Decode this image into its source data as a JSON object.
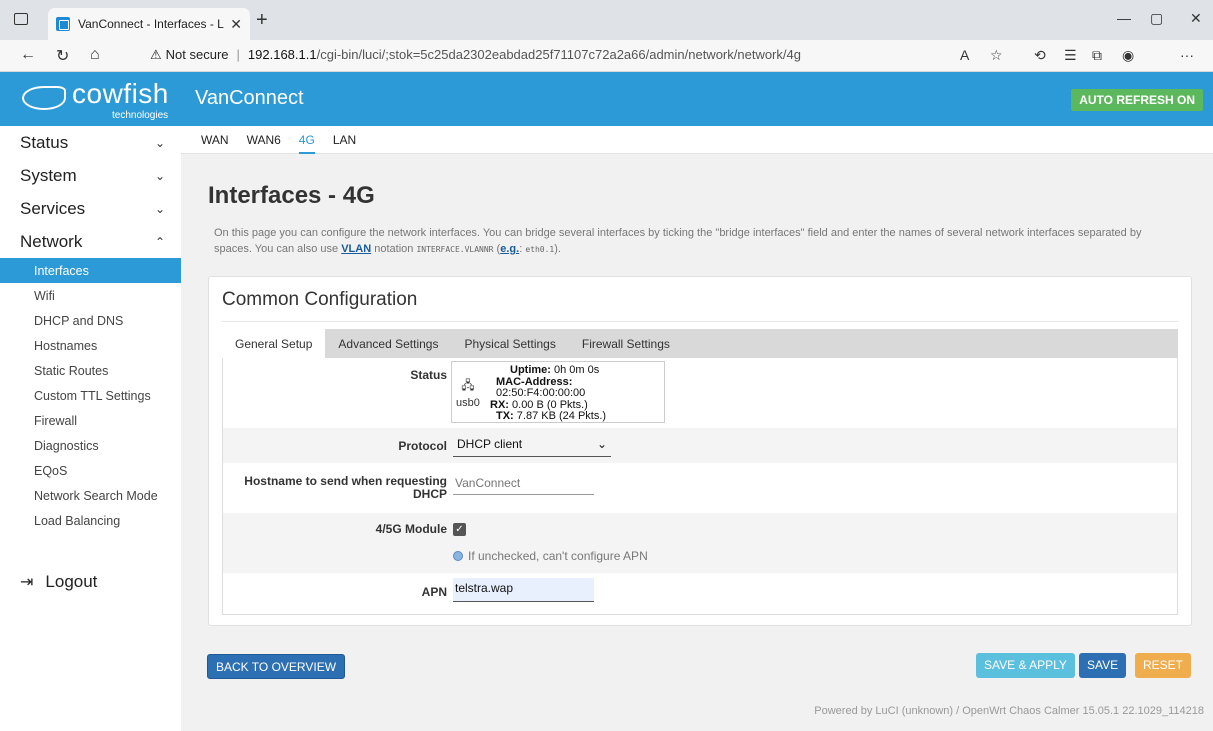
{
  "browser": {
    "tab_title": "VanConnect - Interfaces - LuCI",
    "security": "Not secure",
    "url_host": "192.168.1.1",
    "url_path": "/cgi-bin/luci/;stok=5c25da2302eabdad25f71107c72a2a66/admin/network/network/4g"
  },
  "header": {
    "brand": "cowfish",
    "brand_tag": "technologies",
    "app_name": "VanConnect",
    "auto_refresh": "AUTO REFRESH ON"
  },
  "sidebar": {
    "sections": [
      {
        "label": "Status",
        "chevron": "⌄"
      },
      {
        "label": "System",
        "chevron": "⌄"
      },
      {
        "label": "Services",
        "chevron": "⌄"
      },
      {
        "label": "Network",
        "chevron": "⌃"
      }
    ],
    "network_items": [
      "Interfaces",
      "Wifi",
      "DHCP and DNS",
      "Hostnames",
      "Static Routes",
      "Custom TTL Settings",
      "Firewall",
      "Diagnostics",
      "EQoS",
      "Network Search Mode",
      "Load Balancing"
    ],
    "logout": "Logout"
  },
  "iface_tabs": [
    "WAN",
    "WAN6",
    "4G",
    "LAN"
  ],
  "page": {
    "title": "Interfaces - 4G",
    "desc_1": "On this page you can configure the network interfaces. You can bridge several interfaces by ticking the \"bridge interfaces\" field and enter the names of several network interfaces separated by spaces. You can also use ",
    "desc_link": "VLAN",
    "desc_2": " notation ",
    "desc_code1": "INTERFACE.VLANNR",
    "desc_3": " (",
    "desc_eg": "e.g.",
    "desc_4": ": ",
    "desc_code2": "eth0.1",
    "desc_5": ")."
  },
  "panel": {
    "title": "Common Configuration",
    "tabs": [
      "General Setup",
      "Advanced Settings",
      "Physical Settings",
      "Firewall Settings"
    ]
  },
  "form": {
    "status_label": "Status",
    "device": "usb0",
    "uptime_key": "Uptime:",
    "uptime_val": "0h 0m 0s",
    "mac_key": "MAC-Address:",
    "mac_val": "02:50:F4:00:00:00",
    "rx_key": "RX:",
    "rx_val": "0.00 B (0 Pkts.)",
    "tx_key": "TX:",
    "tx_val": "7.87 KB (24 Pkts.)",
    "protocol_label": "Protocol",
    "protocol_value": "DHCP client",
    "hostname_label_1": "Hostname to send when requesting",
    "hostname_label_2": "DHCP",
    "hostname_placeholder": "VanConnect",
    "module_label": "4/5G Module",
    "module_checked": true,
    "module_hint": "If unchecked, can't configure APN",
    "apn_label": "APN",
    "apn_value": "telstra.wap"
  },
  "buttons": {
    "back": "BACK TO OVERVIEW",
    "save_apply": "SAVE & APPLY",
    "save": "SAVE",
    "reset": "RESET"
  },
  "footer": "Powered by LuCI (unknown) / OpenWrt Chaos Calmer 15.05.1 22.1029_114218",
  "colors": {
    "header": "#2c9ad6",
    "active": "#2c9ad6",
    "auto_refresh": "#5cb85c",
    "btn_primary": "#2c6fb2",
    "btn_apply": "#5bc0de",
    "btn_reset": "#f0ad4e"
  }
}
